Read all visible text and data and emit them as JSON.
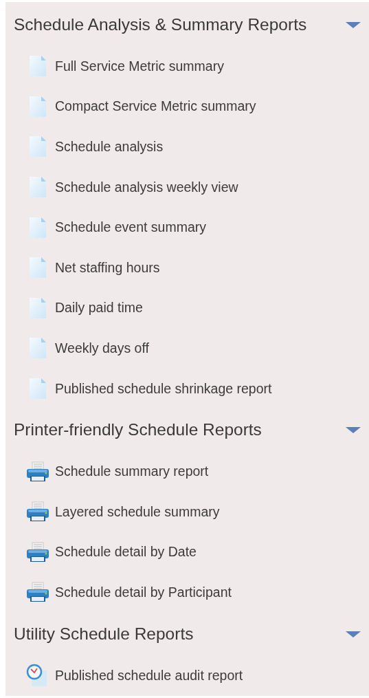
{
  "sections": [
    {
      "title": "Schedule Analysis & Summary Reports",
      "expanded": true,
      "items": [
        {
          "label": "Full Service Metric summary",
          "kind": "document"
        },
        {
          "label": "Compact Service Metric summary",
          "kind": "document"
        },
        {
          "label": "Schedule analysis",
          "kind": "document"
        },
        {
          "label": "Schedule analysis weekly view",
          "kind": "document"
        },
        {
          "label": "Schedule event summary",
          "kind": "document"
        },
        {
          "label": "Net staffing hours",
          "kind": "document"
        },
        {
          "label": "Daily paid time",
          "kind": "document"
        },
        {
          "label": "Weekly days off",
          "kind": "document"
        },
        {
          "label": "Published schedule shrinkage report",
          "kind": "document"
        }
      ]
    },
    {
      "title": "Printer-friendly Schedule Reports",
      "expanded": true,
      "items": [
        {
          "label": "Schedule summary report",
          "kind": "printer"
        },
        {
          "label": "Layered schedule summary",
          "kind": "printer"
        },
        {
          "label": "Schedule detail by Date",
          "kind": "printer"
        },
        {
          "label": "Schedule detail by Participant",
          "kind": "printer"
        }
      ]
    },
    {
      "title": "Utility Schedule Reports",
      "expanded": true,
      "items": [
        {
          "label": "Published schedule audit report",
          "kind": "clock"
        }
      ]
    }
  ]
}
